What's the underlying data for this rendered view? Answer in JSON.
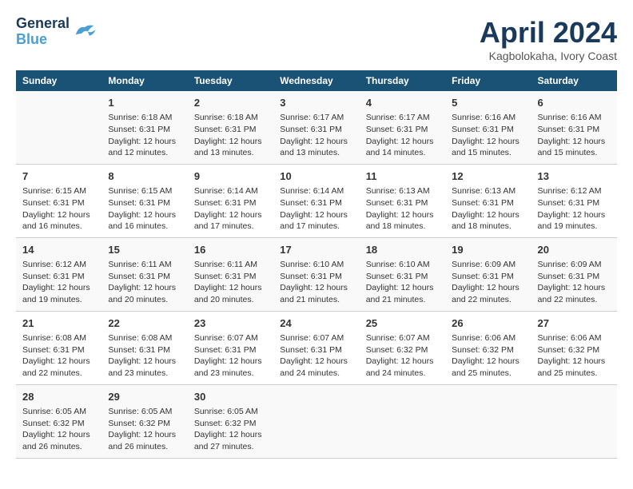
{
  "header": {
    "logo_line1": "General",
    "logo_line2": "Blue",
    "month": "April 2024",
    "location": "Kagbolokaha, Ivory Coast"
  },
  "weekdays": [
    "Sunday",
    "Monday",
    "Tuesday",
    "Wednesday",
    "Thursday",
    "Friday",
    "Saturday"
  ],
  "weeks": [
    [
      {
        "day": "",
        "info": ""
      },
      {
        "day": "1",
        "info": "Sunrise: 6:18 AM\nSunset: 6:31 PM\nDaylight: 12 hours\nand 12 minutes."
      },
      {
        "day": "2",
        "info": "Sunrise: 6:18 AM\nSunset: 6:31 PM\nDaylight: 12 hours\nand 13 minutes."
      },
      {
        "day": "3",
        "info": "Sunrise: 6:17 AM\nSunset: 6:31 PM\nDaylight: 12 hours\nand 13 minutes."
      },
      {
        "day": "4",
        "info": "Sunrise: 6:17 AM\nSunset: 6:31 PM\nDaylight: 12 hours\nand 14 minutes."
      },
      {
        "day": "5",
        "info": "Sunrise: 6:16 AM\nSunset: 6:31 PM\nDaylight: 12 hours\nand 15 minutes."
      },
      {
        "day": "6",
        "info": "Sunrise: 6:16 AM\nSunset: 6:31 PM\nDaylight: 12 hours\nand 15 minutes."
      }
    ],
    [
      {
        "day": "7",
        "info": "Sunrise: 6:15 AM\nSunset: 6:31 PM\nDaylight: 12 hours\nand 16 minutes."
      },
      {
        "day": "8",
        "info": "Sunrise: 6:15 AM\nSunset: 6:31 PM\nDaylight: 12 hours\nand 16 minutes."
      },
      {
        "day": "9",
        "info": "Sunrise: 6:14 AM\nSunset: 6:31 PM\nDaylight: 12 hours\nand 17 minutes."
      },
      {
        "day": "10",
        "info": "Sunrise: 6:14 AM\nSunset: 6:31 PM\nDaylight: 12 hours\nand 17 minutes."
      },
      {
        "day": "11",
        "info": "Sunrise: 6:13 AM\nSunset: 6:31 PM\nDaylight: 12 hours\nand 18 minutes."
      },
      {
        "day": "12",
        "info": "Sunrise: 6:13 AM\nSunset: 6:31 PM\nDaylight: 12 hours\nand 18 minutes."
      },
      {
        "day": "13",
        "info": "Sunrise: 6:12 AM\nSunset: 6:31 PM\nDaylight: 12 hours\nand 19 minutes."
      }
    ],
    [
      {
        "day": "14",
        "info": "Sunrise: 6:12 AM\nSunset: 6:31 PM\nDaylight: 12 hours\nand 19 minutes."
      },
      {
        "day": "15",
        "info": "Sunrise: 6:11 AM\nSunset: 6:31 PM\nDaylight: 12 hours\nand 20 minutes."
      },
      {
        "day": "16",
        "info": "Sunrise: 6:11 AM\nSunset: 6:31 PM\nDaylight: 12 hours\nand 20 minutes."
      },
      {
        "day": "17",
        "info": "Sunrise: 6:10 AM\nSunset: 6:31 PM\nDaylight: 12 hours\nand 21 minutes."
      },
      {
        "day": "18",
        "info": "Sunrise: 6:10 AM\nSunset: 6:31 PM\nDaylight: 12 hours\nand 21 minutes."
      },
      {
        "day": "19",
        "info": "Sunrise: 6:09 AM\nSunset: 6:31 PM\nDaylight: 12 hours\nand 22 minutes."
      },
      {
        "day": "20",
        "info": "Sunrise: 6:09 AM\nSunset: 6:31 PM\nDaylight: 12 hours\nand 22 minutes."
      }
    ],
    [
      {
        "day": "21",
        "info": "Sunrise: 6:08 AM\nSunset: 6:31 PM\nDaylight: 12 hours\nand 22 minutes."
      },
      {
        "day": "22",
        "info": "Sunrise: 6:08 AM\nSunset: 6:31 PM\nDaylight: 12 hours\nand 23 minutes."
      },
      {
        "day": "23",
        "info": "Sunrise: 6:07 AM\nSunset: 6:31 PM\nDaylight: 12 hours\nand 23 minutes."
      },
      {
        "day": "24",
        "info": "Sunrise: 6:07 AM\nSunset: 6:31 PM\nDaylight: 12 hours\nand 24 minutes."
      },
      {
        "day": "25",
        "info": "Sunrise: 6:07 AM\nSunset: 6:32 PM\nDaylight: 12 hours\nand 24 minutes."
      },
      {
        "day": "26",
        "info": "Sunrise: 6:06 AM\nSunset: 6:32 PM\nDaylight: 12 hours\nand 25 minutes."
      },
      {
        "day": "27",
        "info": "Sunrise: 6:06 AM\nSunset: 6:32 PM\nDaylight: 12 hours\nand 25 minutes."
      }
    ],
    [
      {
        "day": "28",
        "info": "Sunrise: 6:05 AM\nSunset: 6:32 PM\nDaylight: 12 hours\nand 26 minutes."
      },
      {
        "day": "29",
        "info": "Sunrise: 6:05 AM\nSunset: 6:32 PM\nDaylight: 12 hours\nand 26 minutes."
      },
      {
        "day": "30",
        "info": "Sunrise: 6:05 AM\nSunset: 6:32 PM\nDaylight: 12 hours\nand 27 minutes."
      },
      {
        "day": "",
        "info": ""
      },
      {
        "day": "",
        "info": ""
      },
      {
        "day": "",
        "info": ""
      },
      {
        "day": "",
        "info": ""
      }
    ]
  ]
}
